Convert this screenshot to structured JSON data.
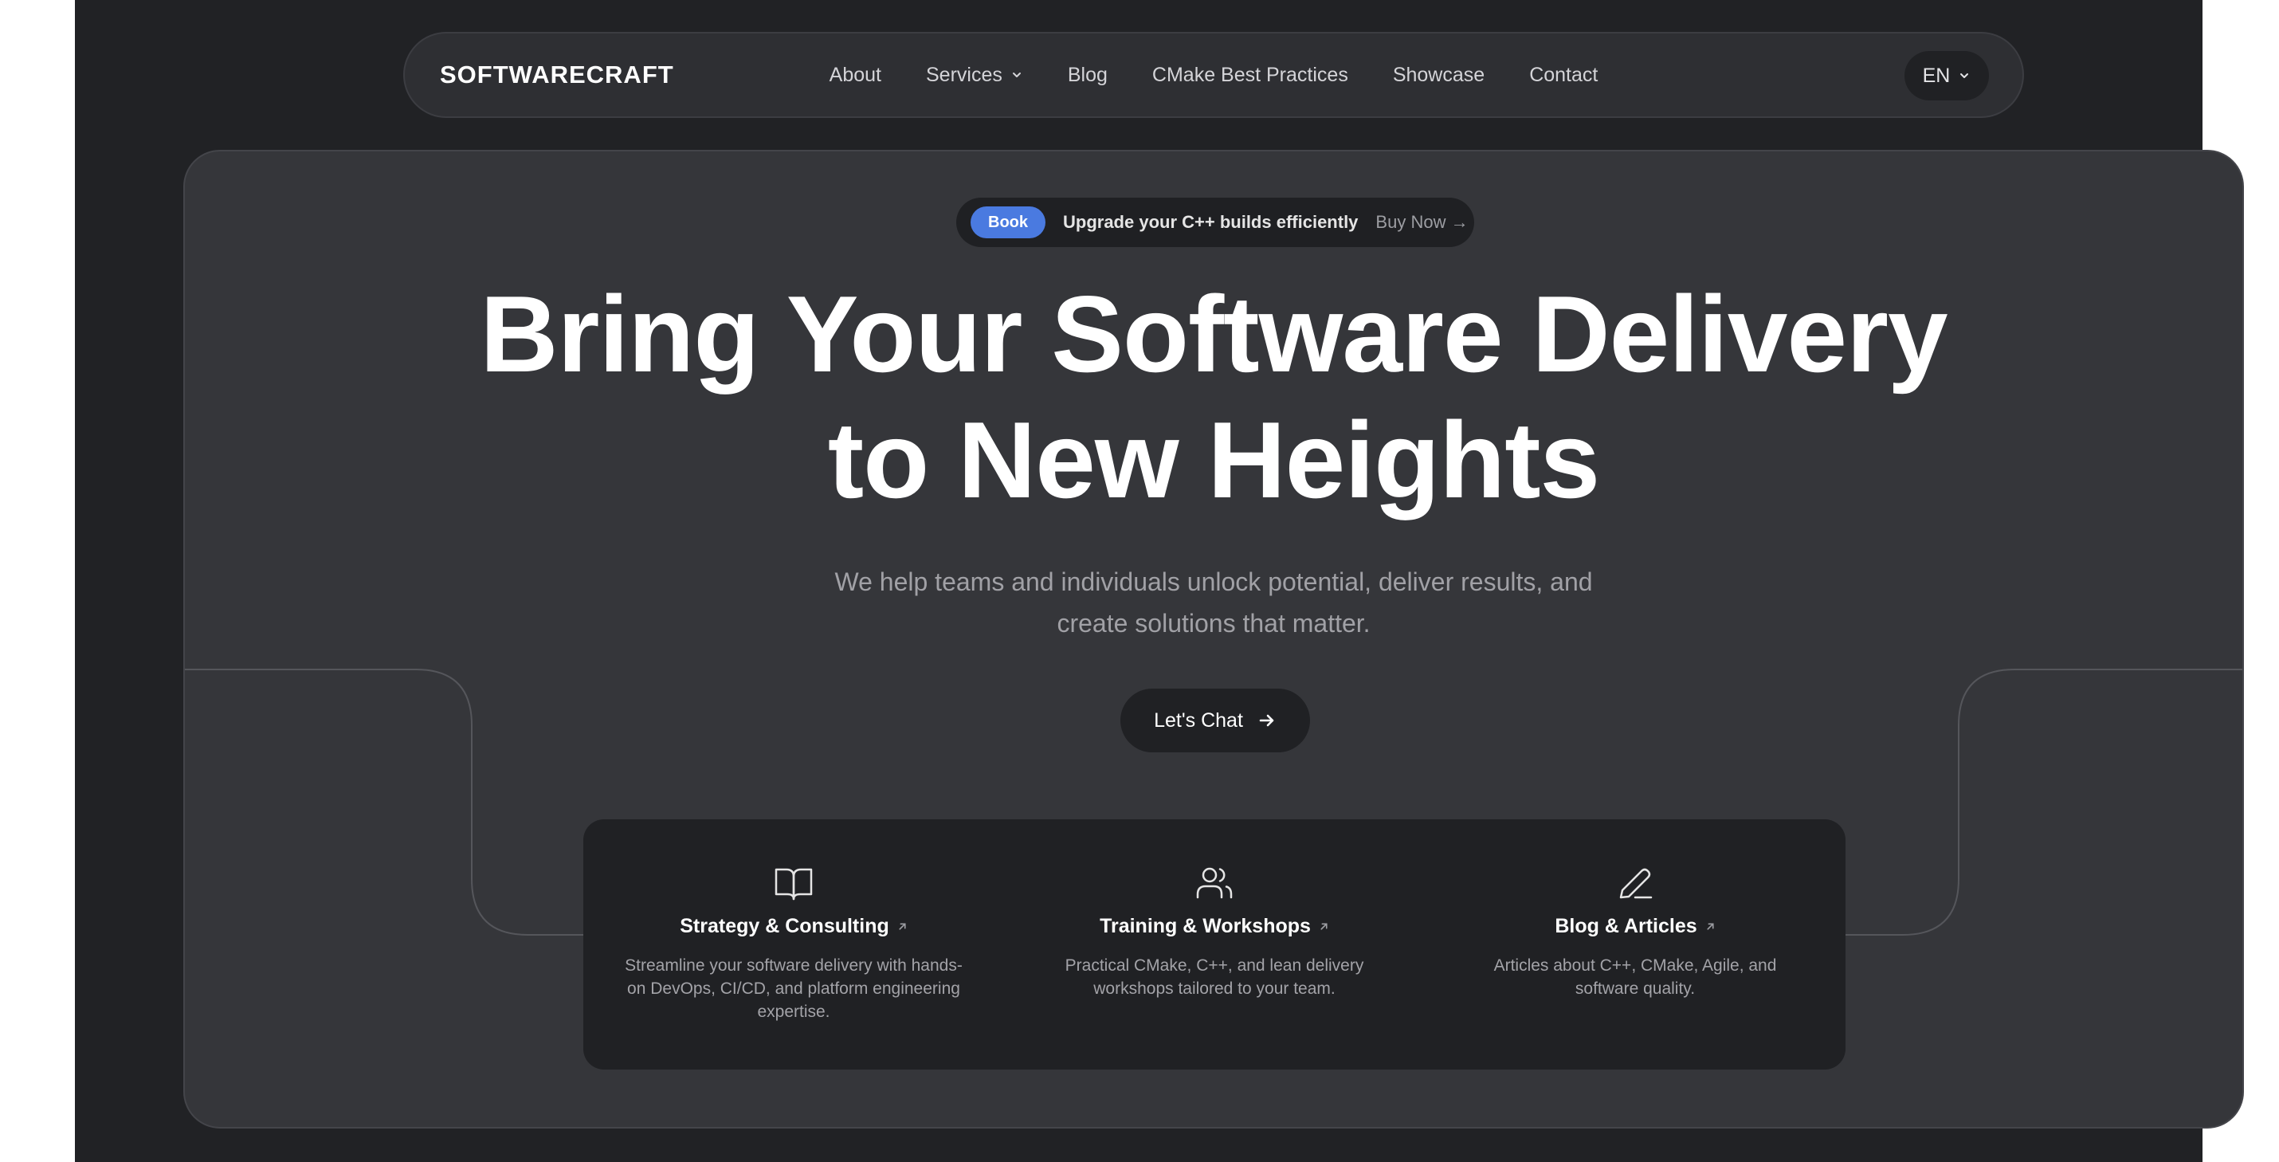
{
  "colors": {
    "page_background": "#212225",
    "hero_background": "#35363a",
    "accent": "#4a7ae0",
    "card_background": "#202124"
  },
  "nav": {
    "brand": "SOFTWARECRAFT",
    "items": [
      {
        "label": "About"
      },
      {
        "label": "Services",
        "icon": "chevron-down-icon"
      },
      {
        "label": "Blog"
      },
      {
        "label": "CMake Best Practices"
      },
      {
        "label": "Showcase"
      },
      {
        "label": "Contact"
      }
    ],
    "language": {
      "label": "EN",
      "icon": "chevron-down-icon"
    }
  },
  "promo": {
    "badge": "Book",
    "text": "Upgrade your C++ builds efficiently",
    "link": "Buy Now →"
  },
  "hero": {
    "headline_line1": "Bring Your Software Delivery",
    "headline_line2": "to New Heights",
    "subtitle_line1": "We help teams and individuals unlock potential, deliver results, and",
    "subtitle_line2": "create solutions that matter.",
    "cta_label": "Let's Chat",
    "cta_icon": "arrow-right-icon"
  },
  "cards": [
    {
      "icon": "book-open-icon",
      "title": "Strategy & Consulting",
      "description": "Streamline your software delivery with hands-on DevOps, CI/CD, and platform engineering expertise."
    },
    {
      "icon": "users-icon",
      "title": "Training & Workshops",
      "description": "Practical CMake, C++, and lean delivery workshops tailored to your team."
    },
    {
      "icon": "pencil-icon",
      "title": "Blog & Articles",
      "description": "Articles about C++, CMake, Agile, and software quality."
    }
  ]
}
